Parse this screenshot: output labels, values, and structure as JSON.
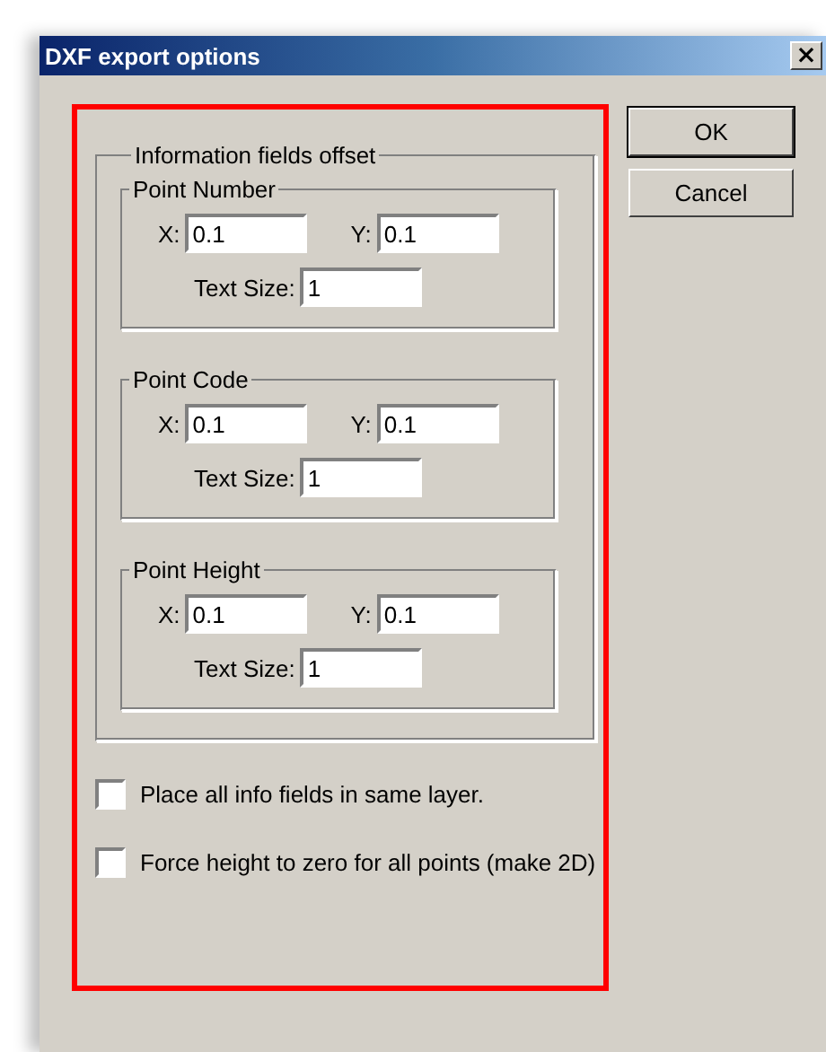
{
  "window": {
    "title": "DXF export options",
    "close": "×"
  },
  "group": {
    "title": "Information fields offset",
    "sections": [
      {
        "title": "Point Number",
        "x_label": "X:",
        "x_value": "0.1",
        "y_label": "Y:",
        "y_value": "0.1",
        "size_label": "Text Size:",
        "size_value": "1"
      },
      {
        "title": "Point Code",
        "x_label": "X:",
        "x_value": "0.1",
        "y_label": "Y:",
        "y_value": "0.1",
        "size_label": "Text Size:",
        "size_value": "1"
      },
      {
        "title": "Point Height",
        "x_label": "X:",
        "x_value": "0.1",
        "y_label": "Y:",
        "y_value": "0.1",
        "size_label": "Text Size:",
        "size_value": "1"
      }
    ]
  },
  "options": [
    {
      "label": "Place all info fields in same layer.",
      "checked": false
    },
    {
      "label": "Force height to zero for all points (make 2D)",
      "checked": false
    }
  ],
  "buttons": [
    "OK",
    "Cancel"
  ]
}
